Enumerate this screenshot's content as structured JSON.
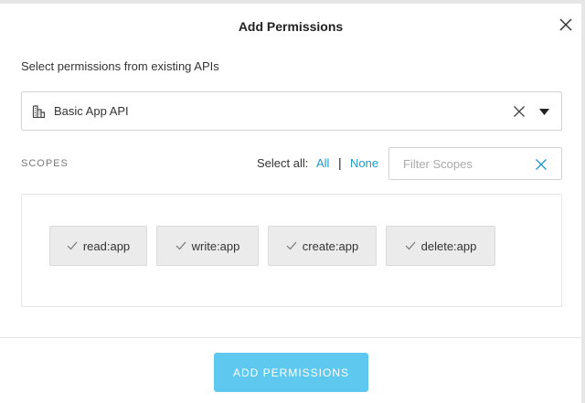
{
  "dialog": {
    "title": "Add Permissions",
    "subtitle": "Select permissions from existing APIs"
  },
  "api_select": {
    "selected": "Basic App API"
  },
  "scopes": {
    "label": "SCOPES",
    "select_all_label": "Select all:",
    "all_label": "All",
    "separator": "|",
    "none_label": "None",
    "filter_placeholder": "Filter Scopes",
    "items": [
      {
        "label": "read:app"
      },
      {
        "label": "write:app"
      },
      {
        "label": "create:app"
      },
      {
        "label": "delete:app"
      }
    ]
  },
  "footer": {
    "add_button": "ADD PERMISSIONS"
  },
  "colors": {
    "accent": "#1e9ac7",
    "button": "#5ec8ee",
    "chip_bg": "#ebebeb"
  },
  "icons": {
    "close": "close-icon",
    "api": "api-building-icon",
    "clear": "clear-icon",
    "caret": "caret-down-icon",
    "check": "check-icon"
  }
}
